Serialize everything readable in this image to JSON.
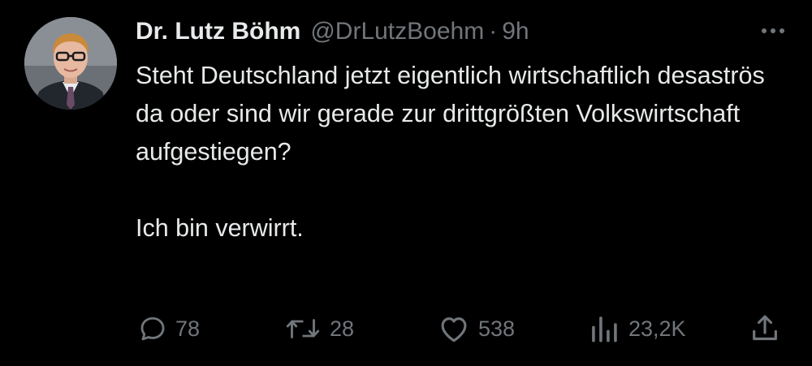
{
  "tweet": {
    "author_name": "Dr. Lutz Böhm",
    "handle": "@DrLutzBoehm",
    "separator": "·",
    "time": "9h",
    "paragraphs": [
      "Steht Deutschland jetzt eigentlich wirtschaftlich desaströs da oder sind wir gerade zur drittgrößten Volkswirtschaft aufgestiegen?",
      "Ich bin verwirrt."
    ],
    "avatar_icon": "profile-photo"
  },
  "actions": {
    "reply": {
      "icon": "reply-bubble-icon",
      "count": "78"
    },
    "repost": {
      "icon": "repost-icon",
      "count": "28"
    },
    "like": {
      "icon": "heart-icon",
      "count": "538"
    },
    "views": {
      "icon": "analytics-bars-icon",
      "count": "23,2K"
    },
    "share": {
      "icon": "share-upload-icon"
    }
  },
  "more_menu": {
    "icon": "more-dots-icon"
  },
  "colors": {
    "background": "#000000",
    "text_primary": "#e7e9ea",
    "text_secondary": "#71767b"
  }
}
